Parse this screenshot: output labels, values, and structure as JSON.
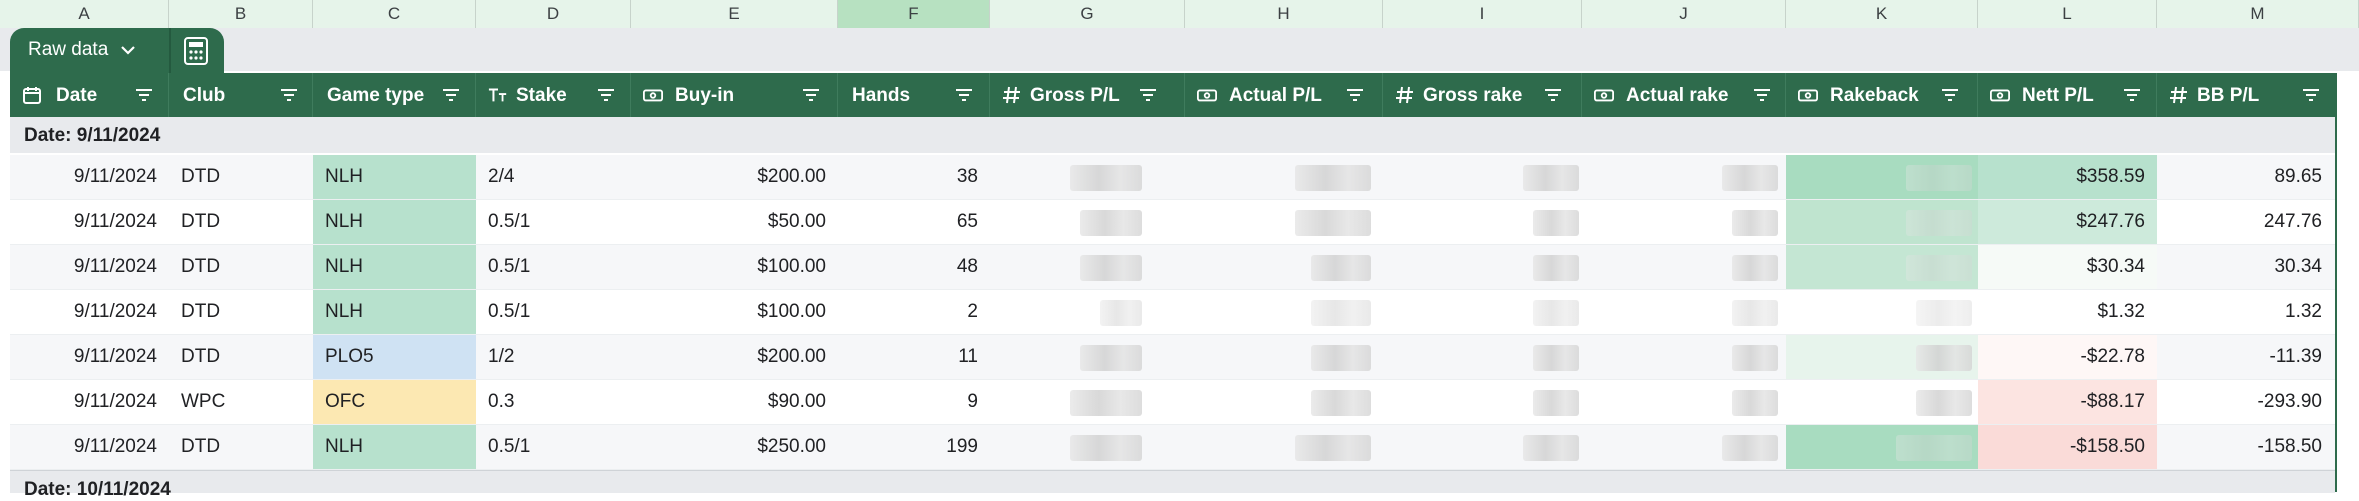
{
  "columns": [
    "A",
    "B",
    "C",
    "D",
    "E",
    "F",
    "G",
    "H",
    "I",
    "J",
    "K",
    "L",
    "M"
  ],
  "table": {
    "name": "Raw data"
  },
  "headers": [
    "Date",
    "Club",
    "Game type",
    "Stake",
    "Buy-in",
    "Hands",
    "Gross P/L",
    "Actual P/L",
    "Gross rake",
    "Actual rake",
    "Rakeback",
    "Nett P/L",
    "BB P/L"
  ],
  "groups": [
    "Date: 9/11/2024",
    "Date: 10/11/2024"
  ],
  "rows": [
    {
      "date": "9/11/2024",
      "club": "DTD",
      "game": "NLH",
      "stake": "2/4",
      "buyin": "$200.00",
      "hands": "38",
      "nett": "$358.59",
      "bb": "89.65"
    },
    {
      "date": "9/11/2024",
      "club": "DTD",
      "game": "NLH",
      "stake": "0.5/1",
      "buyin": "$50.00",
      "hands": "65",
      "nett": "$247.76",
      "bb": "247.76"
    },
    {
      "date": "9/11/2024",
      "club": "DTD",
      "game": "NLH",
      "stake": "0.5/1",
      "buyin": "$100.00",
      "hands": "48",
      "nett": "$30.34",
      "bb": "30.34"
    },
    {
      "date": "9/11/2024",
      "club": "DTD",
      "game": "NLH",
      "stake": "0.5/1",
      "buyin": "$100.00",
      "hands": "2",
      "nett": "$1.32",
      "bb": "1.32"
    },
    {
      "date": "9/11/2024",
      "club": "DTD",
      "game": "PLO5",
      "stake": "1/2",
      "buyin": "$200.00",
      "hands": "11",
      "nett": "-$22.78",
      "bb": "-11.39"
    },
    {
      "date": "9/11/2024",
      "club": "WPC",
      "game": "OFC",
      "stake": "0.3",
      "buyin": "$90.00",
      "hands": "9",
      "nett": "-$88.17",
      "bb": "-293.90"
    },
    {
      "date": "9/11/2024",
      "club": "DTD",
      "game": "NLH",
      "stake": "0.5/1",
      "buyin": "$250.00",
      "hands": "199",
      "nett": "-$158.50",
      "bb": "-158.50"
    }
  ],
  "colors": {
    "header": "#2e6b4c",
    "nlh": "#b7e1cd",
    "plo": "#cfe2f3",
    "ofc": "#fce8b2"
  }
}
